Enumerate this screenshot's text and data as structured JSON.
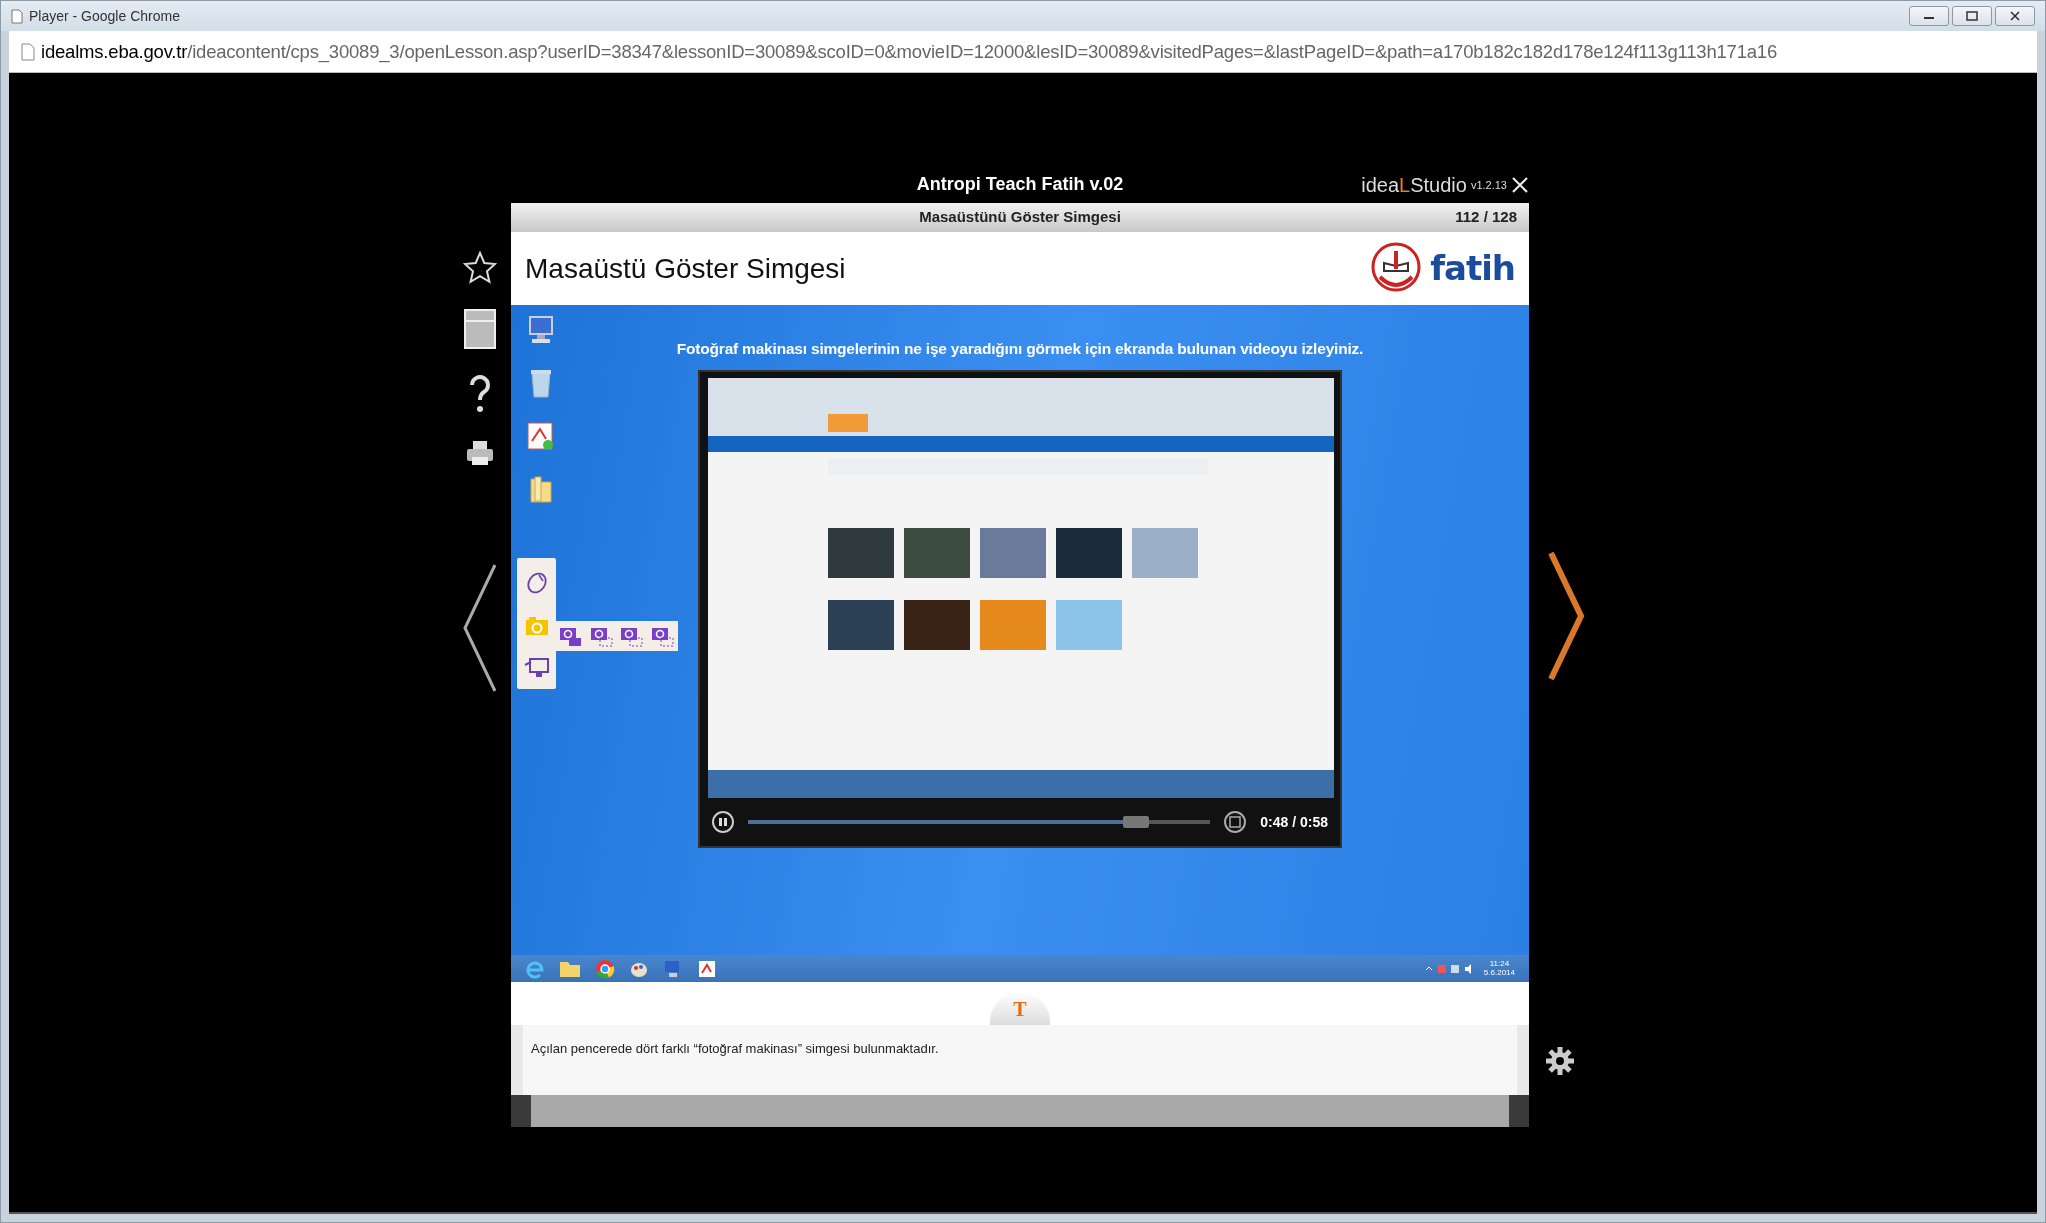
{
  "browser": {
    "title": "Player - Google Chrome",
    "url_host": "idealms.eba.gov.tr",
    "url_path": "/ideacontent/cps_30089_3/openLesson.asp?userID=38347&lessonID=30089&scoID=0&movieID=12000&lesID=30089&visitedPages=&lastPageID=&path=a170b182c182d178e124f113g113h171a16"
  },
  "player": {
    "app_title": "Antropi Teach Fatih v.02",
    "brand": {
      "prefix": "idea",
      "accent": "L",
      "suffix": "Studio"
    },
    "version": "v1.2.13"
  },
  "slide": {
    "section_title": "Masaüstünü Göster Simgesi",
    "page": "112 / 128",
    "title": "Masaüstü Göster Simgesi",
    "logo_text": "fatih",
    "instruction": "Fotoğraf makinası simgelerinin ne işe yaradığını görmek için ekranda bulunan videoyu izleyiniz.",
    "video": {
      "kind": "picture",
      "playing": true,
      "level": 0.84,
      "time": "0:48 / 0:58"
    },
    "taskbar": {
      "time": "11:24",
      "date": "5.6.2014"
    }
  },
  "caption": {
    "tab": "T",
    "text": "Açılan pencerede dört farklı “fotoğraf makinası” simgesi bulunmaktadır."
  }
}
